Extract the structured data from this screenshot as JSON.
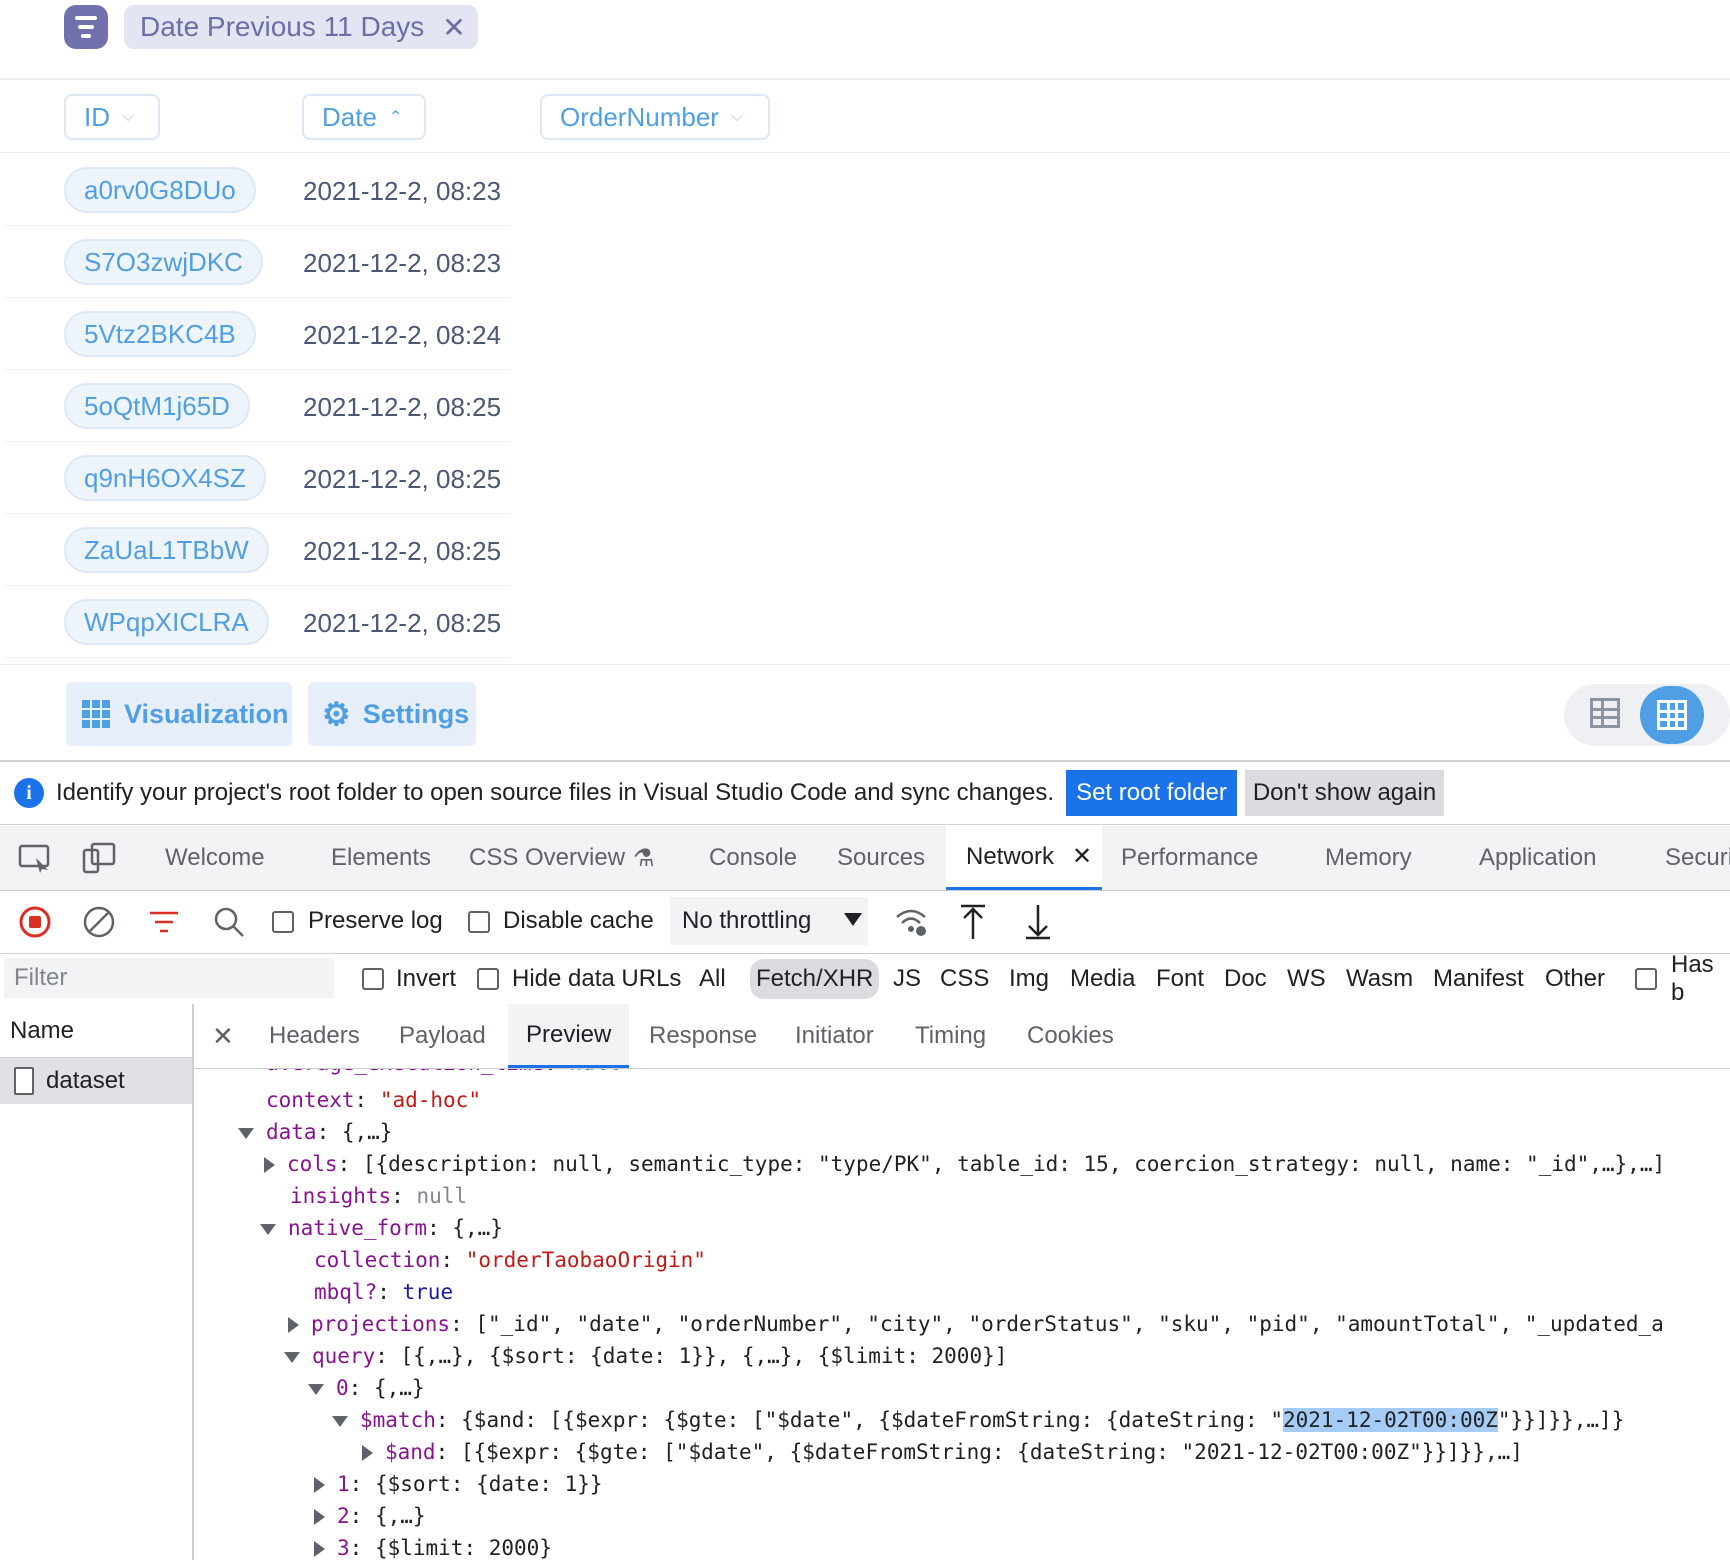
{
  "filter": {
    "label": "Date Previous 11 Days",
    "remove": "✕"
  },
  "columns": {
    "id": "ID",
    "date": "Date",
    "order_number": "OrderNumber"
  },
  "rows": [
    {
      "id": "a0rv0G8DUo",
      "date": "2021-12-2, 08:23"
    },
    {
      "id": "S7O3zwjDKC",
      "date": "2021-12-2, 08:23"
    },
    {
      "id": "5Vtz2BKC4B",
      "date": "2021-12-2, 08:24"
    },
    {
      "id": "5oQtM1j65D",
      "date": "2021-12-2, 08:25"
    },
    {
      "id": "q9nH6OX4SZ",
      "date": "2021-12-2, 08:25"
    },
    {
      "id": "ZaUaL1TBbW",
      "date": "2021-12-2, 08:25"
    },
    {
      "id": "WPqpXICLRA",
      "date": "2021-12-2, 08:25"
    }
  ],
  "footer": {
    "visualization": "Visualization",
    "settings": "Settings"
  },
  "infobar": {
    "message": "Identify your project's root folder to open source files in Visual Studio Code and sync changes.",
    "set_root": "Set root folder",
    "dont_show": "Don't show again"
  },
  "devtools_tabs": [
    "Welcome",
    "Elements",
    "CSS Overview",
    "Console",
    "Sources",
    "Network",
    "Performance",
    "Memory",
    "Application",
    "Securi"
  ],
  "toolbar": {
    "preserve_log": "Preserve log",
    "disable_cache": "Disable cache",
    "throttling": "No throttling"
  },
  "filterbar": {
    "placeholder": "Filter",
    "invert": "Invert",
    "hide_data_urls": "Hide data URLs",
    "types": [
      "All",
      "Fetch/XHR",
      "JS",
      "CSS",
      "Img",
      "Media",
      "Font",
      "Doc",
      "WS",
      "Wasm",
      "Manifest",
      "Other"
    ],
    "has_blocked": "Has b"
  },
  "name_panel": {
    "header": "Name",
    "item": "dataset"
  },
  "detail_tabs": [
    "Headers",
    "Payload",
    "Preview",
    "Response",
    "Initiator",
    "Timing",
    "Cookies"
  ],
  "preview": {
    "l0_key": "average_execution_time",
    "l0_val": "null",
    "l1_key": "context",
    "l1_val": "\"ad-hoc\"",
    "l2_key": "data",
    "l2_val": "{,…}",
    "l3_key": "cols",
    "l3_val": "[{description: null, semantic_type: \"type/PK\", table_id: 15, coercion_strategy: null, name: \"_id\",…},…]",
    "l4_key": "insights",
    "l4_val": "null",
    "l5_key": "native_form",
    "l5_val": "{,…}",
    "l6_key": "collection",
    "l6_val": "\"orderTaobaoOrigin\"",
    "l7_key": "mbql?",
    "l7_val": "true",
    "l8_key": "projections",
    "l8_val": "[\"_id\", \"date\", \"orderNumber\", \"city\", \"orderStatus\", \"sku\", \"pid\", \"amountTotal\", \"_updated_a",
    "l9_key": "query",
    "l9_val": "[{,…}, {$sort: {date: 1}}, {,…}, {$limit: 2000}]",
    "l10_key": "0",
    "l10_val": "{,…}",
    "l11_key": "$match",
    "l11_pre": "{$and: [{$expr: {$gte: [\"$date\", {$dateFromString: {dateString: \"",
    "l11_hl": "2021-12-02T00:00Z",
    "l11_post": "\"}}]}},…]}",
    "l12_key": "$and",
    "l12_val": "[{$expr: {$gte: [\"$date\", {$dateFromString: {dateString: \"2021-12-02T00:00Z\"}}]}},…]",
    "l13_key": "1",
    "l13_val": "{$sort: {date: 1}}",
    "l14_key": "2",
    "l14_val": "{,…}",
    "l15_key": "3",
    "l15_val": "{$limit: 2000}"
  },
  "colors": {
    "metabase_brand": "#509ee3",
    "filter_purple": "#7172ad",
    "devtools_blue": "#1a73e8"
  }
}
